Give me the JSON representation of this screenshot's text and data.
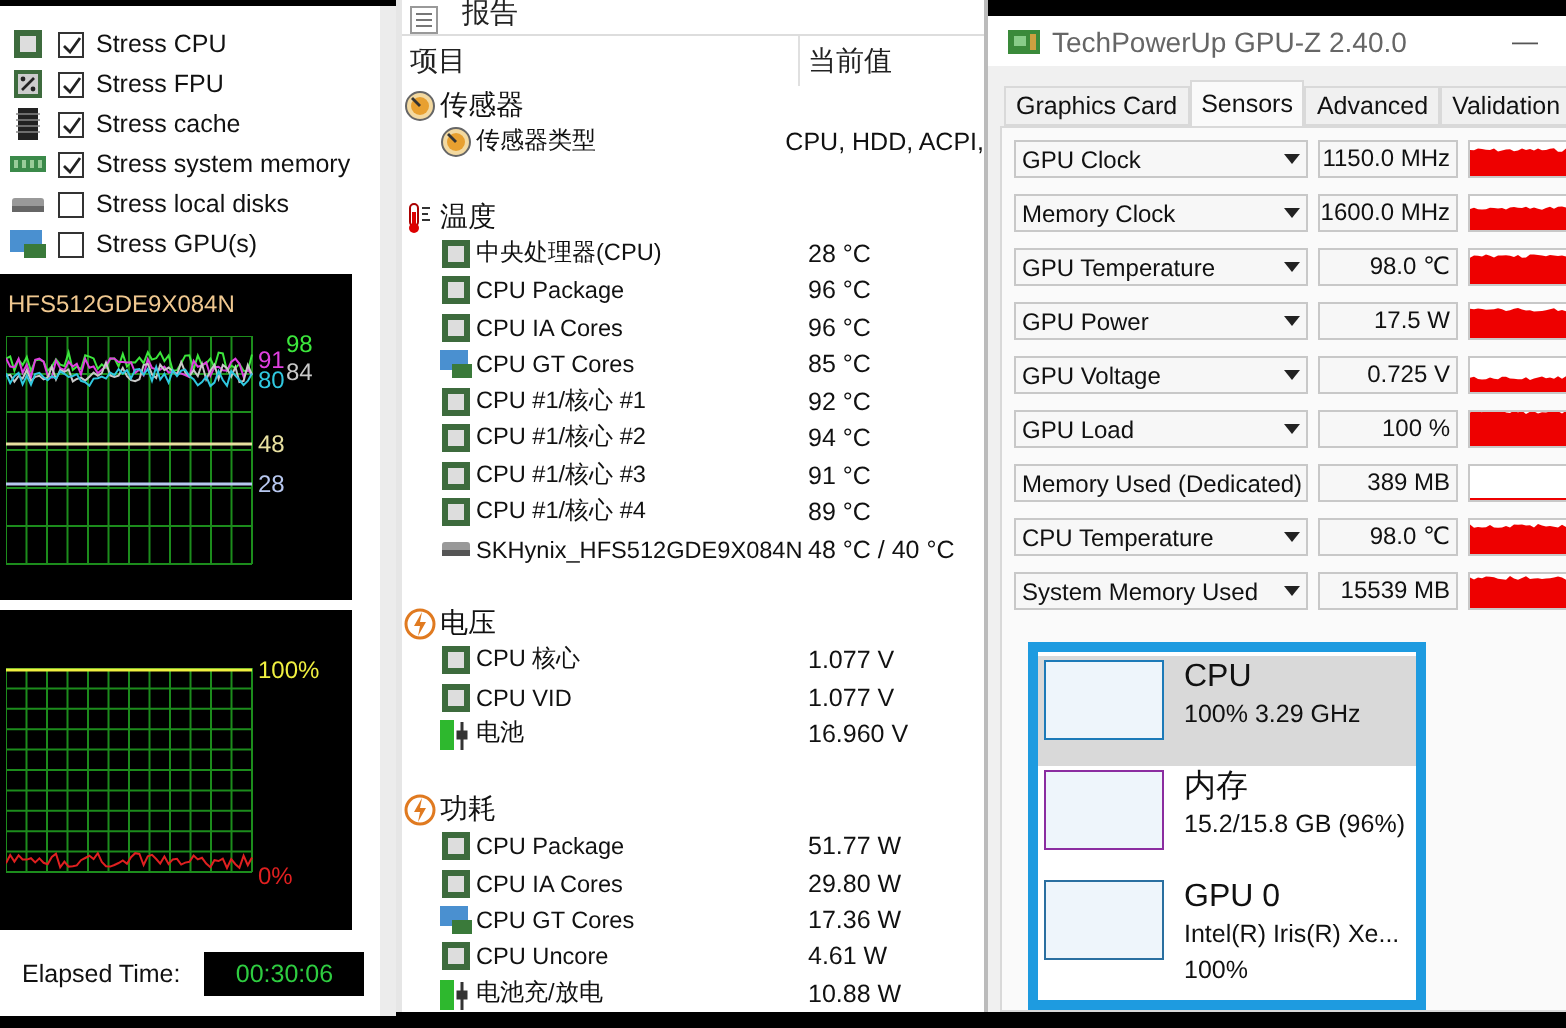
{
  "stress_options": [
    {
      "label": "Stress CPU",
      "checked": true,
      "kind": "cpu"
    },
    {
      "label": "Stress FPU",
      "checked": true,
      "kind": "fpu"
    },
    {
      "label": "Stress cache",
      "checked": true,
      "kind": "cache"
    },
    {
      "label": "Stress system memory",
      "checked": true,
      "kind": "memory"
    },
    {
      "label": "Stress local disks",
      "checked": false,
      "kind": "disk"
    },
    {
      "label": "Stress GPU(s)",
      "checked": false,
      "kind": "gpu"
    }
  ],
  "temperature_graph": {
    "title": "HFS512GDE9X084N",
    "labels": [
      {
        "text": "98",
        "color": "#3ce63c"
      },
      {
        "text": "91",
        "color": "#e040e0"
      },
      {
        "text": "84",
        "color": "#c8c8c8"
      },
      {
        "text": "80",
        "color": "#30c8e0"
      },
      {
        "text": "48",
        "color": "#e8e0a0"
      },
      {
        "text": "28",
        "color": "#b8c8f0"
      }
    ]
  },
  "usage_graph": {
    "labels": [
      {
        "text": "100%",
        "color": "#f0f040"
      },
      {
        "text": "0%",
        "color": "#e02020"
      }
    ]
  },
  "elapsed": {
    "label": "Elapsed Time:",
    "value": "00:30:06"
  },
  "report": {
    "title": "报告",
    "columns": [
      "项目",
      "当前值"
    ],
    "groups": [
      {
        "label": "传感器",
        "kind": "gauge",
        "children": [
          {
            "label": "传感器类型",
            "value": "CPU, HDD, ACPI,",
            "kind": "gauge"
          }
        ]
      },
      {
        "label": "温度",
        "kind": "thermometer",
        "children": [
          {
            "label": "中央处理器(CPU)",
            "value": "28 °C",
            "kind": "chip"
          },
          {
            "label": "CPU Package",
            "value": "96 °C",
            "kind": "chip"
          },
          {
            "label": "CPU IA Cores",
            "value": "96 °C",
            "kind": "chip"
          },
          {
            "label": "CPU GT Cores",
            "value": "85 °C",
            "kind": "gpu"
          },
          {
            "label": "CPU #1/核心 #1",
            "value": "92 °C",
            "kind": "chip"
          },
          {
            "label": "CPU #1/核心 #2",
            "value": "94 °C",
            "kind": "chip"
          },
          {
            "label": "CPU #1/核心 #3",
            "value": "91 °C",
            "kind": "chip"
          },
          {
            "label": "CPU #1/核心 #4",
            "value": "89 °C",
            "kind": "chip"
          },
          {
            "label": "SKHynix_HFS512GDE9X084N",
            "value": "48 °C / 40 °C",
            "kind": "disk"
          }
        ]
      },
      {
        "label": "电压",
        "kind": "bolt",
        "children": [
          {
            "label": "CPU 核心",
            "value": "1.077 V",
            "kind": "chip"
          },
          {
            "label": "CPU VID",
            "value": "1.077 V",
            "kind": "chip"
          },
          {
            "label": "电池",
            "value": "16.960 V",
            "kind": "battery"
          }
        ]
      },
      {
        "label": "功耗",
        "kind": "bolt",
        "children": [
          {
            "label": "CPU Package",
            "value": "51.77 W",
            "kind": "chip"
          },
          {
            "label": "CPU IA Cores",
            "value": "29.80 W",
            "kind": "chip"
          },
          {
            "label": "CPU GT Cores",
            "value": "17.36 W",
            "kind": "gpu"
          },
          {
            "label": "CPU Uncore",
            "value": "4.61 W",
            "kind": "chip"
          },
          {
            "label": "电池充/放电",
            "value": "10.88 W",
            "kind": "battery"
          }
        ]
      }
    ]
  },
  "gpuz": {
    "title": "TechPowerUp GPU-Z 2.40.0",
    "minimize": "—",
    "tabs": [
      {
        "label": "Graphics Card",
        "selected": false
      },
      {
        "label": "Sensors",
        "selected": true
      },
      {
        "label": "Advanced",
        "selected": false
      },
      {
        "label": "Validation",
        "selected": false
      }
    ],
    "sensors": [
      {
        "name": "GPU Clock",
        "value": "1150.0 MHz"
      },
      {
        "name": "Memory Clock",
        "value": "1600.0 MHz"
      },
      {
        "name": "GPU Temperature",
        "value": "98.0 ℃"
      },
      {
        "name": "GPU Power",
        "value": "17.5 W"
      },
      {
        "name": "GPU Voltage",
        "value": "0.725 V"
      },
      {
        "name": "GPU Load",
        "value": "100 %"
      },
      {
        "name": "Memory Used (Dedicated)",
        "value": "389 MB"
      },
      {
        "name": "CPU Temperature",
        "value": "98.0 ℃"
      },
      {
        "name": "System Memory Used",
        "value": "15539 MB"
      }
    ]
  },
  "task_manager": {
    "items": [
      {
        "name": "CPU",
        "details": [
          "100% 3.29 GHz"
        ],
        "selected": true,
        "color": "#1c7ab8"
      },
      {
        "name": "内存",
        "details": [
          "15.2/15.8 GB (96%)"
        ],
        "selected": false,
        "color": "#8b2da0"
      },
      {
        "name": "GPU 0",
        "details": [
          "Intel(R) Iris(R) Xe...",
          "100%"
        ],
        "selected": false,
        "color": "#2a6fa0"
      }
    ]
  }
}
